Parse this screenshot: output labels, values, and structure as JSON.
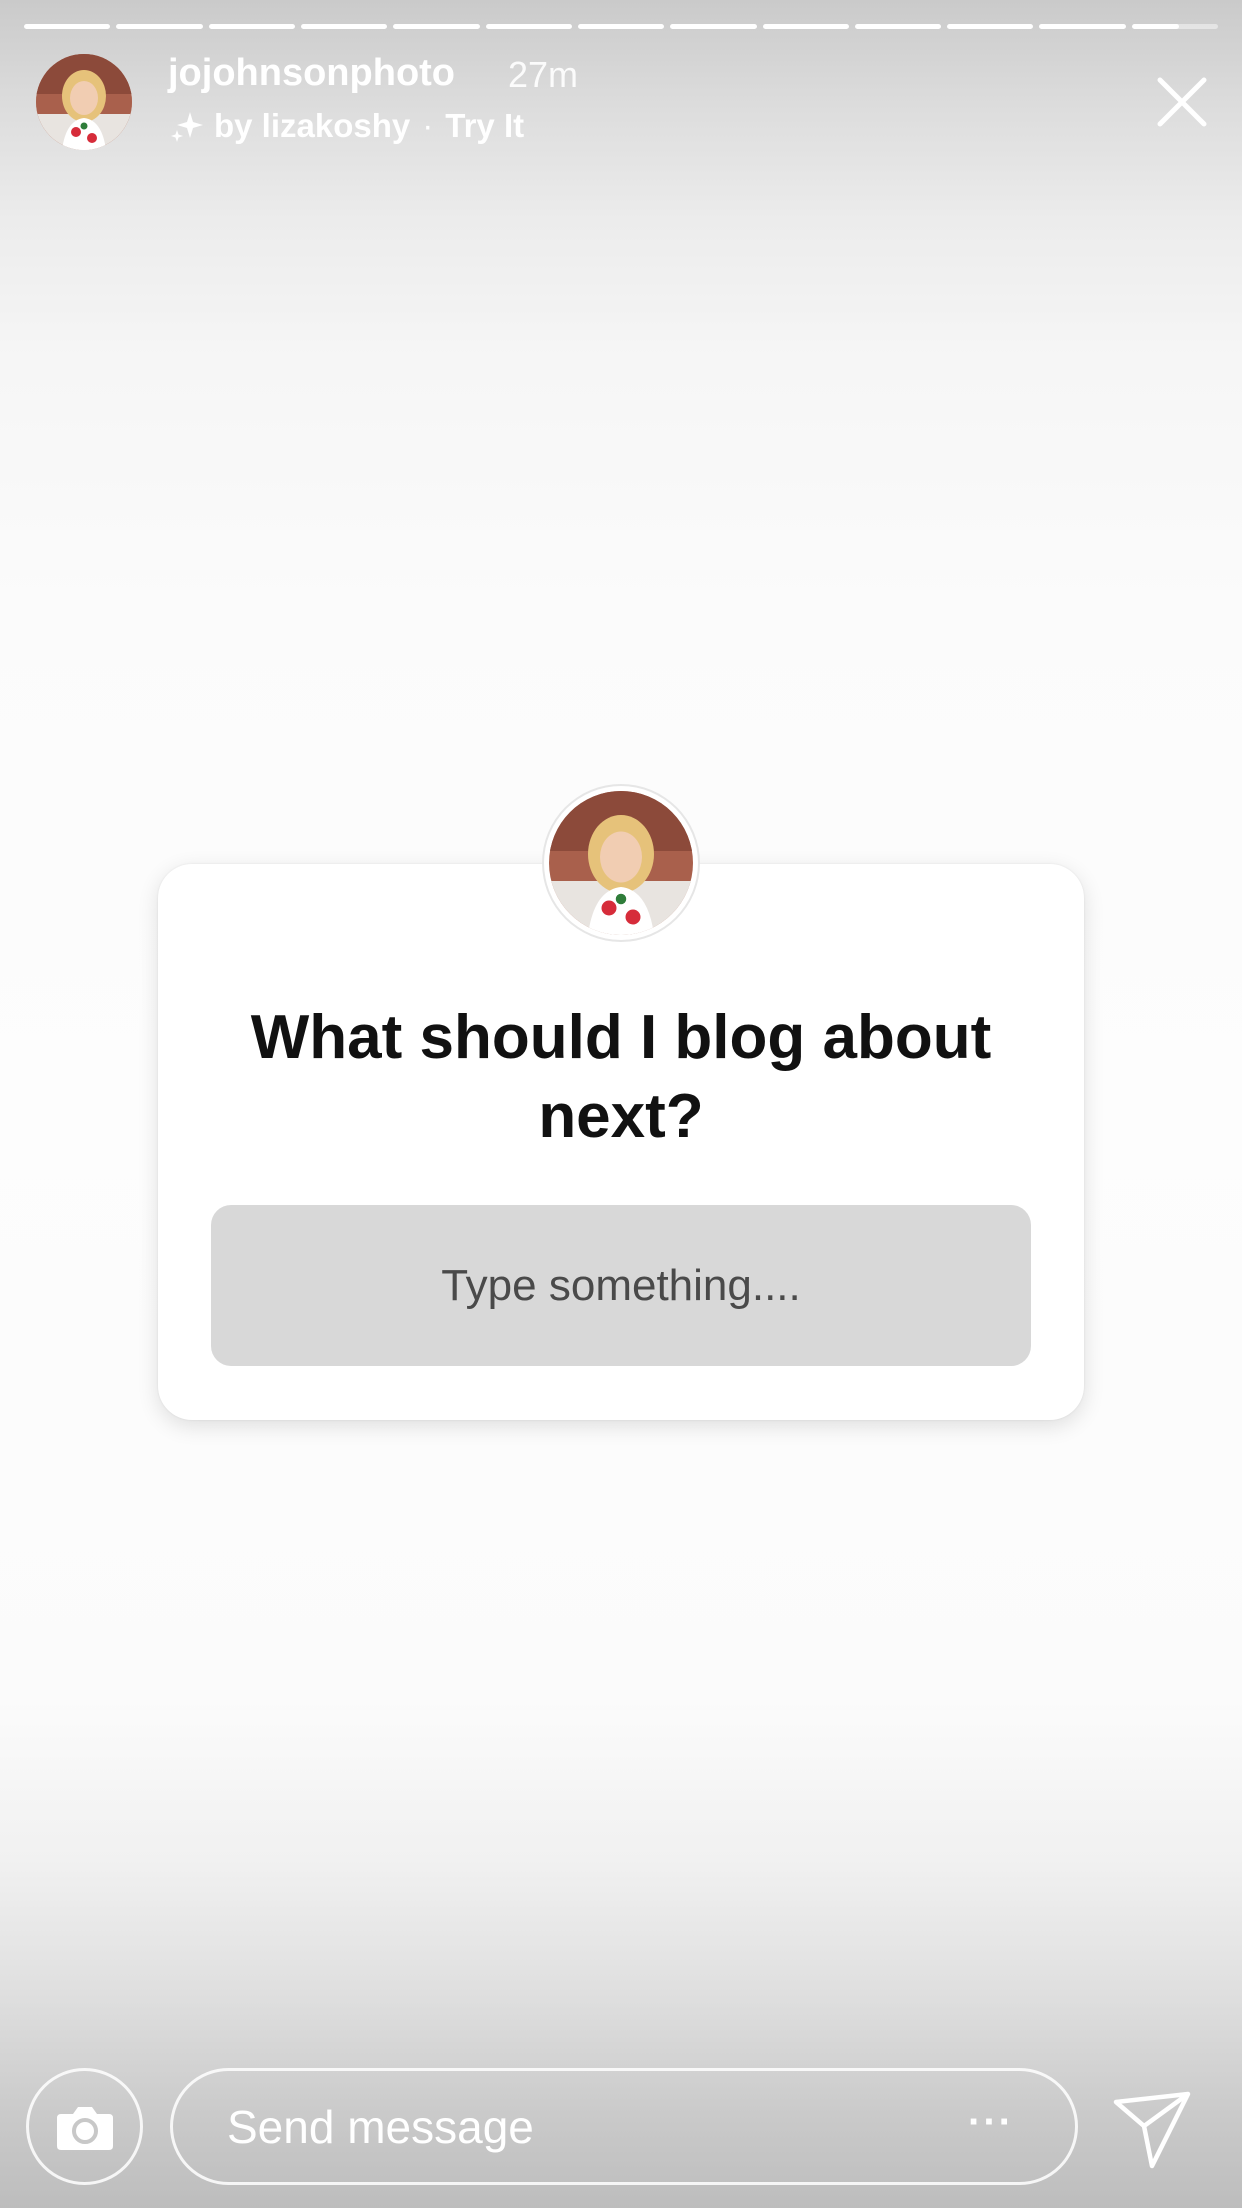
{
  "story": {
    "progress_segments": [
      1,
      1,
      1,
      1,
      1,
      1,
      1,
      1,
      1,
      1,
      1,
      1,
      0.55
    ],
    "username": "jojohnsonphoto",
    "timestamp": "27m",
    "effect_by": "by lizakoshy",
    "effect_separator": "·",
    "effect_action": "Try It"
  },
  "sticker": {
    "question": "What should I blog about next?",
    "input_placeholder": "Type something...."
  },
  "reply_bar": {
    "placeholder": "Send message",
    "more_label": "···"
  },
  "icons": {
    "avatar": "profile-photo",
    "sparkle": "sparkle-icon",
    "close": "close-icon",
    "camera": "camera-icon",
    "more": "more-icon",
    "send": "send-icon"
  },
  "colors": {
    "sticker_background": "#ffffff",
    "input_background": "#d8d8d8",
    "question_text": "#111111",
    "overlay_text": "#ffffff"
  }
}
